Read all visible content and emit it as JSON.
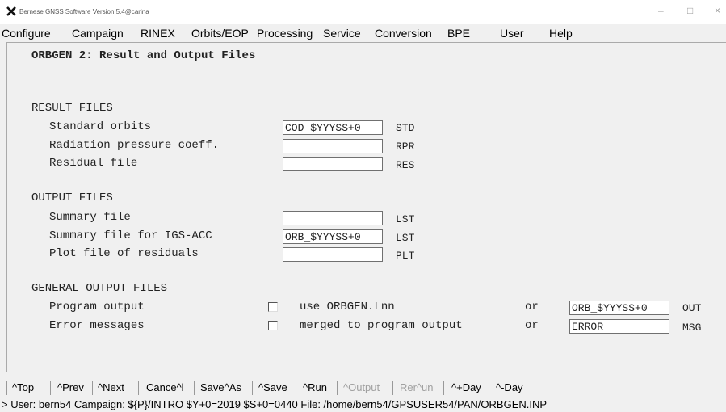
{
  "window": {
    "title": "Bernese GNSS Software Version 5.4@carina",
    "minimize": "–",
    "maximize": "□",
    "close": "×"
  },
  "menu": {
    "items": [
      "Configure",
      "Campaign",
      "RINEX",
      "Orbits/EOP",
      "Processing",
      "Service",
      "Conversion",
      "BPE",
      "User",
      "Help"
    ]
  },
  "panel": {
    "title": "ORBGEN 2: Result and Output Files",
    "result_files": {
      "heading": "RESULT FILES",
      "rows": [
        {
          "label": "Standard orbits",
          "value": "COD_$YYYSS+0",
          "ext": "STD"
        },
        {
          "label": "Radiation pressure coeff.",
          "value": "",
          "ext": "RPR"
        },
        {
          "label": "Residual file",
          "value": "",
          "ext": "RES"
        }
      ]
    },
    "output_files": {
      "heading": "OUTPUT FILES",
      "rows": [
        {
          "label": "Summary file",
          "value": "",
          "ext": "LST"
        },
        {
          "label": "Summary file for IGS-ACC",
          "value": "ORB_$YYYSS+0",
          "ext": "LST"
        },
        {
          "label": "Plot file of residuals",
          "value": "",
          "ext": "PLT"
        }
      ]
    },
    "general_output": {
      "heading": "GENERAL OUTPUT FILES",
      "rows": [
        {
          "label": "Program output",
          "option": "use ORBGEN.Lnn",
          "or": "or",
          "value": "ORB_$YYYSS+0",
          "ext": "OUT",
          "checked": false
        },
        {
          "label": "Error messages",
          "option": "merged to program output",
          "or": "or",
          "value": "ERROR",
          "ext": "MSG",
          "checked": false
        }
      ]
    }
  },
  "bottombar": {
    "items": [
      {
        "label": "^Top",
        "enabled": true
      },
      {
        "label": "^Prev",
        "enabled": true
      },
      {
        "label": "^Next",
        "enabled": true
      },
      {
        "label": "Cance^l",
        "enabled": true
      },
      {
        "label": "Save^As",
        "enabled": true
      },
      {
        "label": "^Save",
        "enabled": true
      },
      {
        "label": "^Run",
        "enabled": true
      },
      {
        "label": "^Output",
        "enabled": false
      },
      {
        "label": "Rer^un",
        "enabled": false
      },
      {
        "label": "^+Day",
        "enabled": true
      },
      {
        "label": "^-Day",
        "enabled": true
      }
    ]
  },
  "status": {
    "text": "> User: bern54  Campaign: ${P}/INTRO  $Y+0=2019  $S+0=0440  File: /home/bern54/GPSUSER54/PAN/ORBGEN.INP"
  }
}
